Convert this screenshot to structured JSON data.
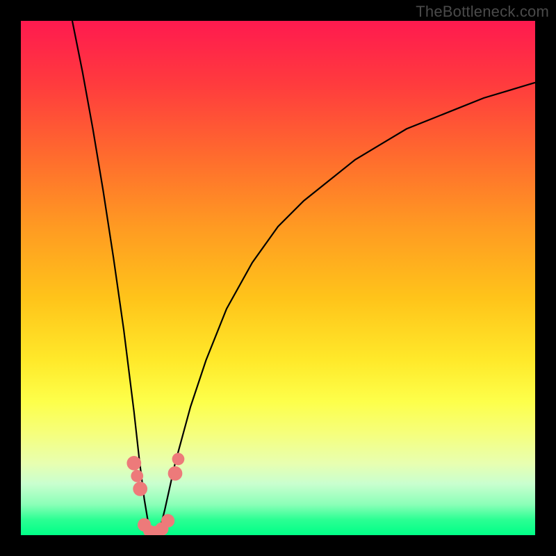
{
  "watermark": "TheBottleneck.com",
  "chart_data": {
    "type": "line",
    "title": "",
    "xlabel": "",
    "ylabel": "",
    "xlim": [
      0,
      100
    ],
    "ylim": [
      0,
      100
    ],
    "series": [
      {
        "name": "bottleneck-curve",
        "x": [
          10,
          12,
          14,
          16,
          18,
          20,
          21,
          22,
          23,
          24,
          25,
          26,
          27,
          28,
          30,
          33,
          36,
          40,
          45,
          50,
          55,
          60,
          65,
          70,
          75,
          80,
          85,
          90,
          95,
          100
        ],
        "y": [
          100,
          90,
          79,
          67,
          54,
          40,
          32,
          24,
          15,
          7,
          1,
          0,
          1,
          5,
          14,
          25,
          34,
          44,
          53,
          60,
          65,
          69,
          73,
          76,
          79,
          81,
          83,
          85,
          86.5,
          88
        ]
      }
    ],
    "markers": [
      {
        "name": "left-cluster-top",
        "x": 22.0,
        "y": 14.0,
        "r": 1.4
      },
      {
        "name": "left-cluster-mid",
        "x": 22.6,
        "y": 11.5,
        "r": 1.2
      },
      {
        "name": "left-cluster-low",
        "x": 23.2,
        "y": 9.0,
        "r": 1.4
      },
      {
        "name": "valley-left-1",
        "x": 24.0,
        "y": 2.0,
        "r": 1.3
      },
      {
        "name": "valley-left-2",
        "x": 25.0,
        "y": 0.8,
        "r": 1.2
      },
      {
        "name": "valley-mid-1",
        "x": 26.2,
        "y": 0.6,
        "r": 1.2
      },
      {
        "name": "valley-mid-2",
        "x": 27.4,
        "y": 1.2,
        "r": 1.3
      },
      {
        "name": "valley-right",
        "x": 28.6,
        "y": 2.8,
        "r": 1.3
      },
      {
        "name": "right-cluster-low",
        "x": 30.0,
        "y": 12.0,
        "r": 1.4
      },
      {
        "name": "right-cluster-top",
        "x": 30.6,
        "y": 14.8,
        "r": 1.2
      }
    ],
    "marker_color": "#ed7a7a",
    "curve_color": "#000000"
  }
}
